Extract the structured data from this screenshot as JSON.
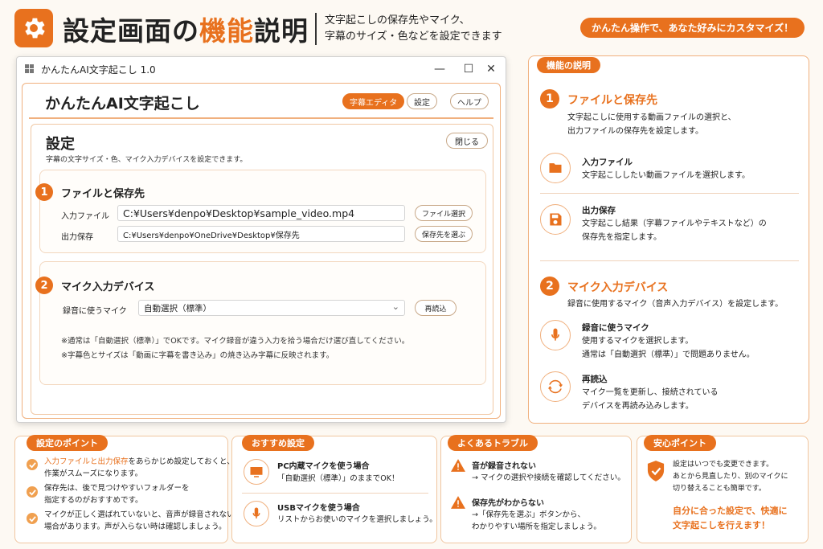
{
  "header": {
    "title_pre": "設定画面の",
    "title_hl": "機能",
    "title_post": "説明",
    "desc_line1": "文字起こしの保存先やマイク、",
    "desc_line2": "字幕のサイズ・色などを設定できます",
    "pill": "かんたん操作で、あなた好みにカスタマイズ！"
  },
  "window": {
    "title": "かんたんAI文字起こし 1.0",
    "minimize": "—",
    "maximize": "☐",
    "close": "✕"
  },
  "app": {
    "title": "かんたんAI文字起こし",
    "nav": [
      "字幕エディタ",
      "設定",
      "ヘルプ"
    ]
  },
  "settings": {
    "title": "設定",
    "subtitle": "字幕の文字サイズ・色、マイク入力デバイスを設定できます。",
    "close_label": "閉じる",
    "section1": {
      "num": "1",
      "title": "ファイルと保存先",
      "input_label": "入力ファイル",
      "input_value": "C:¥Users¥denpo¥Desktop¥sample_video.mp4",
      "input_button": "ファイル選択",
      "output_label": "出力保存",
      "output_value": "C:¥Users¥denpo¥OneDrive¥Desktop¥保存先",
      "output_button": "保存先を選ぶ"
    },
    "section2": {
      "num": "2",
      "title": "マイク入力デバイス",
      "mic_label": "録音に使うマイク",
      "mic_value": "自動選択（標準）",
      "reload_button": "再読込",
      "note1": "※通常は「自動選択（標準）」でOKです。マイク録音が違う入力を拾う場合だけ選び直してください。",
      "note2": "※字幕色とサイズは「動画に字幕を書き込み」の焼き込み字幕に反映されます。"
    }
  },
  "explain": {
    "tag": "機能の説明",
    "s1": {
      "num": "1",
      "head": "ファイルと保存先",
      "desc1": "文字起こしに使用する動画ファイルの選択と、",
      "desc2": "出力ファイルの保存先を設定します。",
      "item1_title": "入力ファイル",
      "item1_desc": "文字起こししたい動画ファイルを選択します。",
      "item2_title": "出力保存",
      "item2_desc1": "文字起こし結果（字幕ファイルやテキストなど）の",
      "item2_desc2": "保存先を指定します。"
    },
    "s2": {
      "num": "2",
      "head": "マイク入力デバイス",
      "desc": "録音に使用するマイク（音声入力デバイス）を設定します。",
      "item1_title": "録音に使うマイク",
      "item1_desc1": "使用するマイクを選択します。",
      "item1_desc2": "通常は「自動選択（標準）」で問題ありません。",
      "item2_title": "再読込",
      "item2_desc1": "マイク一覧を更新し、接続されている",
      "item2_desc2": "デバイスを再読み込みします。"
    }
  },
  "cards": {
    "points": {
      "tag": "設定のポイント",
      "p1_hl": "入力ファイルと出力保存",
      "p1_rest": "をあらかじめ設定しておくと、",
      "p1_line2": "作業がスムーズになります。",
      "p2_line1": "保存先は、後で見つけやすいフォルダーを",
      "p2_line2": "指定するのがおすすめです。",
      "p3_line1": "マイクが正しく選ばれていないと、音声が録音されない",
      "p3_line2": "場合があります。声が入らない時は確認しましょう。"
    },
    "recommend": {
      "tag": "おすすめ設定",
      "r1_title": "PC内蔵マイクを使う場合",
      "r1_desc": "「自動選択（標準）」のままでOK！",
      "r2_title": "USBマイクを使う場合",
      "r2_desc": "リストからお使いのマイクを選択しましょう。"
    },
    "trouble": {
      "tag": "よくあるトラブル",
      "t1_title": "音が録音されない",
      "t1_desc": "→ マイクの選択や接続を確認してください。",
      "t2_title": "保存先がわからない",
      "t2_desc1": "→「保存先を選ぶ」ボタンから、",
      "t2_desc2": "わかりやすい場所を指定しましょう。"
    },
    "safe": {
      "tag": "安心ポイント",
      "line1": "設定はいつでも変更できます。",
      "line2": "あとから見直したり、別のマイクに",
      "line3": "切り替えることも簡単です。",
      "hl1": "自分に合った設定で、快適に",
      "hl2": "文字起こしを行えます！"
    }
  },
  "colors": {
    "accent": "#e8711e",
    "accent_light": "#f0b07e",
    "bg": "#fdf9f3"
  }
}
